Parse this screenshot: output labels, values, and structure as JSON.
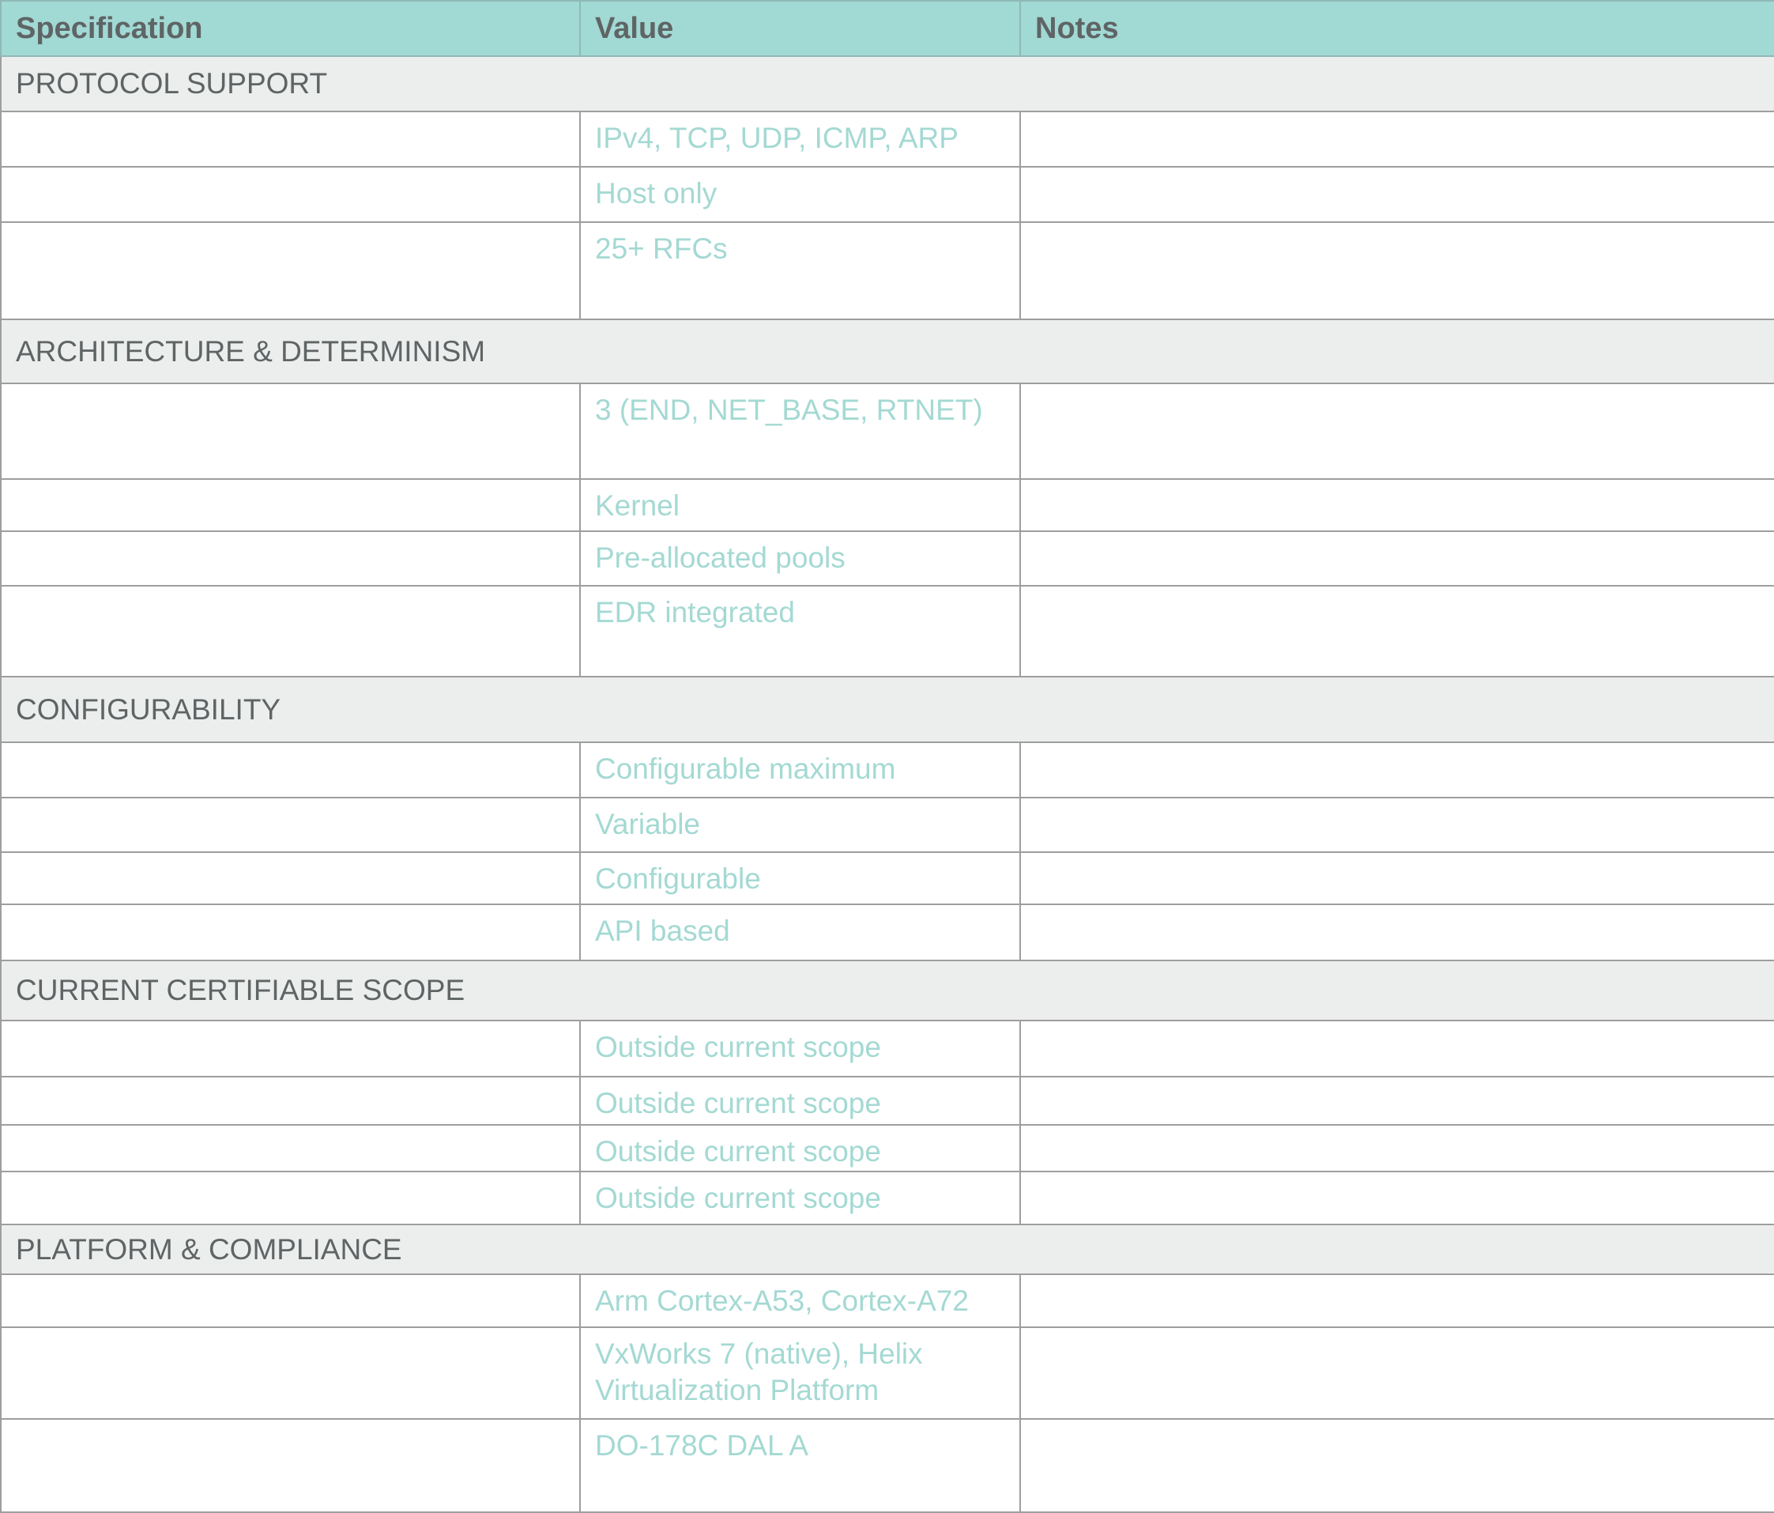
{
  "table": {
    "headers": [
      "Specification",
      "Value",
      "Notes"
    ],
    "sections": [
      {
        "title": "PROTOCOL SUPPORT",
        "rows": [
          {
            "spec": "",
            "value": "IPv4, TCP, UDP, ICMP, ARP",
            "notes": ""
          },
          {
            "spec": "",
            "value": "Host only",
            "notes": ""
          },
          {
            "spec": "",
            "value": "25+ RFCs",
            "notes": ""
          }
        ]
      },
      {
        "title": "ARCHITECTURE & DETERMINISM",
        "rows": [
          {
            "spec": "",
            "value": "3 (END, NET_BASE, RTNET)",
            "notes": ""
          },
          {
            "spec": "",
            "value": "Kernel",
            "notes": ""
          },
          {
            "spec": "",
            "value": "Pre-allocated pools",
            "notes": ""
          },
          {
            "spec": "",
            "value": "EDR integrated",
            "notes": ""
          }
        ]
      },
      {
        "title": "CONFIGURABILITY",
        "rows": [
          {
            "spec": "",
            "value": "Configurable maximum",
            "notes": ""
          },
          {
            "spec": "",
            "value": "Variable",
            "notes": ""
          },
          {
            "spec": "",
            "value": "Configurable",
            "notes": ""
          },
          {
            "spec": "",
            "value": "API based",
            "notes": ""
          }
        ]
      },
      {
        "title": "CURRENT CERTIFIABLE SCOPE",
        "rows": [
          {
            "spec": "",
            "value": "Outside current scope",
            "notes": ""
          },
          {
            "spec": "",
            "value": "Outside current scope",
            "notes": ""
          },
          {
            "spec": "",
            "value": "Outside current scope",
            "notes": ""
          },
          {
            "spec": "",
            "value": "Outside current scope",
            "notes": ""
          }
        ]
      },
      {
        "title": "PLATFORM & COMPLIANCE",
        "rows": [
          {
            "spec": "",
            "value": "Arm Cortex-A53, Cortex-A72",
            "notes": ""
          },
          {
            "spec": "",
            "value": "VxWorks 7 (native), Helix Virtualization Platform",
            "notes": ""
          },
          {
            "spec": "",
            "value": "DO-178C DAL A",
            "notes": ""
          }
        ]
      }
    ]
  }
}
